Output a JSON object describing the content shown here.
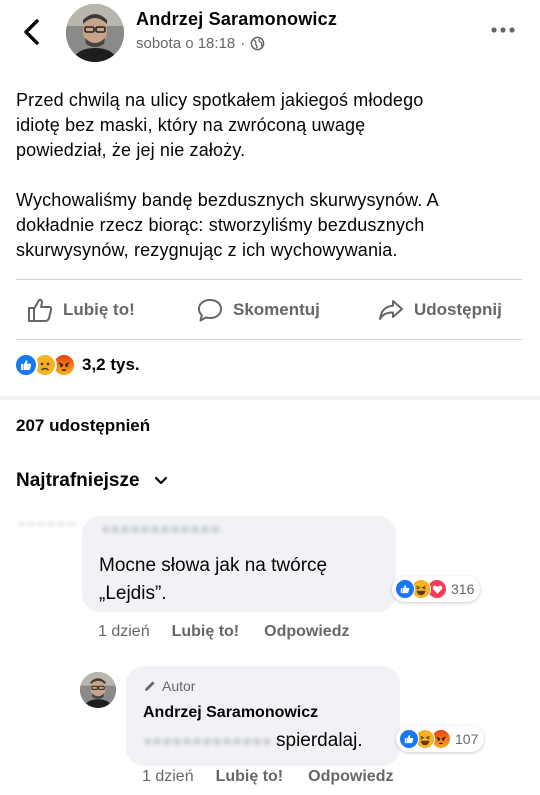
{
  "post": {
    "author": "Andrzej Saramonowicz",
    "timestamp": "sobota o 18:18",
    "separator": "·",
    "audience_icon": "globe-icon",
    "paragraphs": [
      "Przed chwilą na ulicy spotkałem jakiegoś młodego\nidiotę bez maski, który na zwróconą uwagę\npowiedział, że jej nie założy.",
      "Wychowaliśmy bandę bezdusznych skurwysynów. A\ndokładnie rzecz biorąc: stworzyliśmy bezdusznych\nskurwysynów, rezygnując z ich wychowywania."
    ]
  },
  "actions": {
    "like": "Lubię to!",
    "comment": "Skomentuj",
    "share": "Udostępnij"
  },
  "reactions": {
    "types": [
      "like",
      "sad",
      "angry"
    ],
    "count": "3,2 tys."
  },
  "shares": "207 udostępnień",
  "comments_sort": "Najtrafniejsze",
  "comments": [
    {
      "text": "Mocne słowa jak na twórcę\n„Lejdis”.",
      "reactions": [
        "like",
        "haha",
        "love"
      ],
      "reaction_count": "316",
      "time": "1 dzień",
      "like_label": "Lubię to!",
      "reply_label": "Odpowiedz"
    },
    {
      "badge": "Autor",
      "author": "Andrzej Saramonowicz",
      "text": "spierdalaj.",
      "reactions": [
        "like",
        "haha",
        "angry"
      ],
      "reaction_count": "107",
      "time": "1 dzień",
      "like_label": "Lubię to!",
      "reply_label": "Odpowiedz"
    }
  ],
  "colors": {
    "like_blue": "#1877f2",
    "love_red": "#f33e58",
    "emoji_yellow": "#f7b125",
    "angry_orange": "#e9710f",
    "secondary_text": "#65676b",
    "bubble_bg": "#f0f2f5"
  }
}
